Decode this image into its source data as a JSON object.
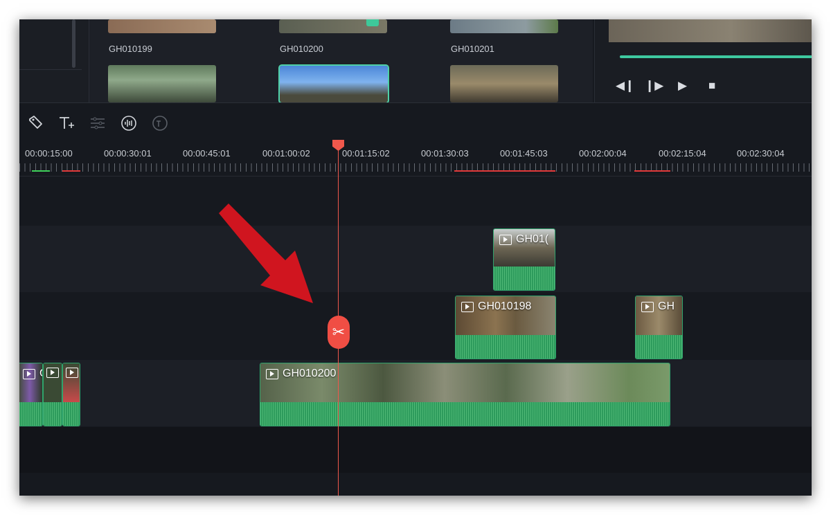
{
  "media": {
    "thumbs": [
      {
        "label": "GH010199"
      },
      {
        "label": "GH010200"
      },
      {
        "label": "GH010201"
      }
    ]
  },
  "preview": {
    "progress": 1.0,
    "buttons": [
      "step-back",
      "step-forward",
      "play",
      "stop"
    ]
  },
  "toolbar": {
    "icons": [
      "tag-icon",
      "text-add-icon",
      "adjust-icon",
      "audio-wave-icon",
      "speech-to-text-icon"
    ]
  },
  "ruler": {
    "ticks": [
      "00:00:15:00",
      "00:00:30:01",
      "00:00:45:01",
      "00:01:00:02",
      "00:01:15:02",
      "00:01:30:03",
      "00:01:45:03",
      "00:02:00:04",
      "00:02:15:04",
      "00:02:30:04"
    ]
  },
  "clips": {
    "track1": {
      "title": "GH01("
    },
    "track2a": {
      "title": "GH010198"
    },
    "track2b": {
      "title": "GH"
    },
    "main": {
      "title": "GH010200"
    },
    "left_small": {
      "title": "GI"
    }
  },
  "colors": {
    "accent": "#3ec9a0",
    "playhead": "#f0584c",
    "annotation_arrow": "#d0151f"
  }
}
